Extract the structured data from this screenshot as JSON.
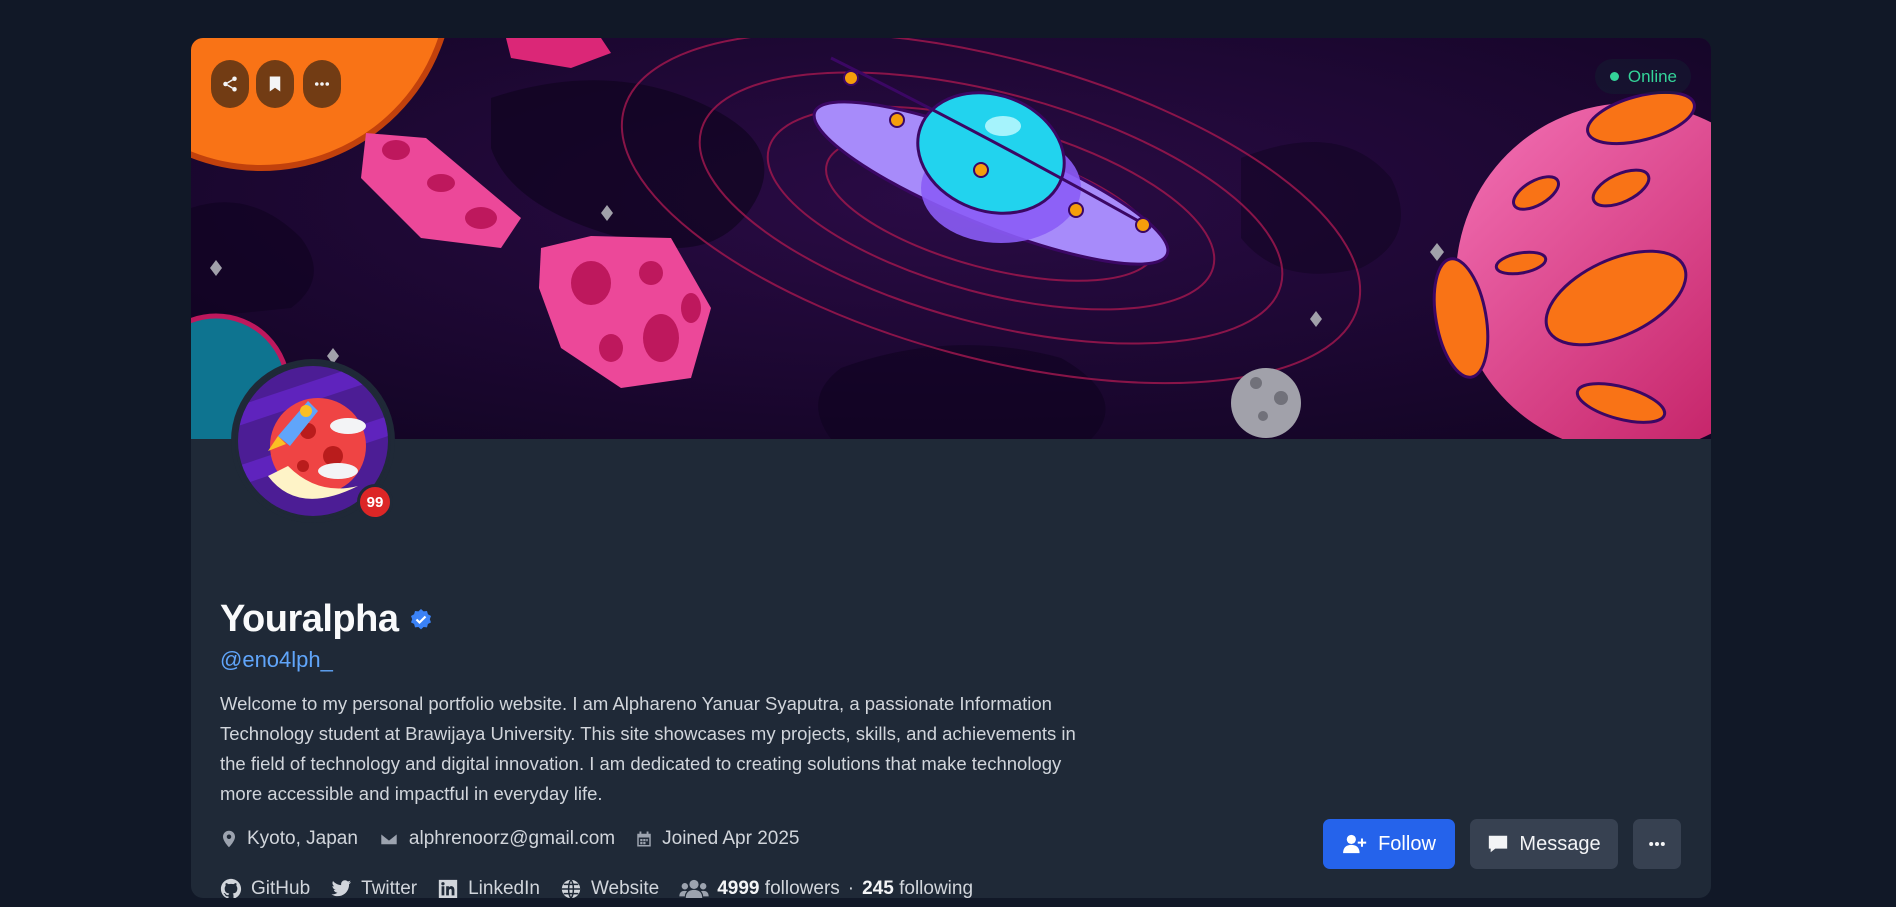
{
  "banner": {
    "status_label": "Online",
    "icons": [
      "share-icon",
      "bookmark-icon",
      "ellipsis-icon"
    ]
  },
  "profile": {
    "name": "Youralpha",
    "handle": "@eno4lph_",
    "notification_count": "99",
    "bio": "Welcome to my personal portfolio website. I am Alphareno Yanuar Syaputra, a passionate Information Technology student at Brawijaya University. This site showcases my projects, skills, and achievements in the field of technology and digital innovation. I am dedicated to creating solutions that make technology more accessible and impactful in everyday life."
  },
  "meta": {
    "location": "Kyoto, Japan",
    "email": "alphrenoorz@gmail.com",
    "joined": "Joined Apr 2025"
  },
  "links": {
    "github": "GitHub",
    "twitter": "Twitter",
    "linkedin": "LinkedIn",
    "website": "Website"
  },
  "stats": {
    "followers_count": "4999",
    "followers_label": "followers",
    "separator": "·",
    "following_count": "245",
    "following_label": "following"
  },
  "actions": {
    "follow_label": "Follow",
    "message_label": "Message"
  },
  "colors": {
    "page_bg": "#111827",
    "card_bg": "#1f2937",
    "accent_blue": "#2563eb",
    "handle_blue": "#60a5fa",
    "online_green": "#34d399",
    "badge_red": "#dc2626"
  }
}
